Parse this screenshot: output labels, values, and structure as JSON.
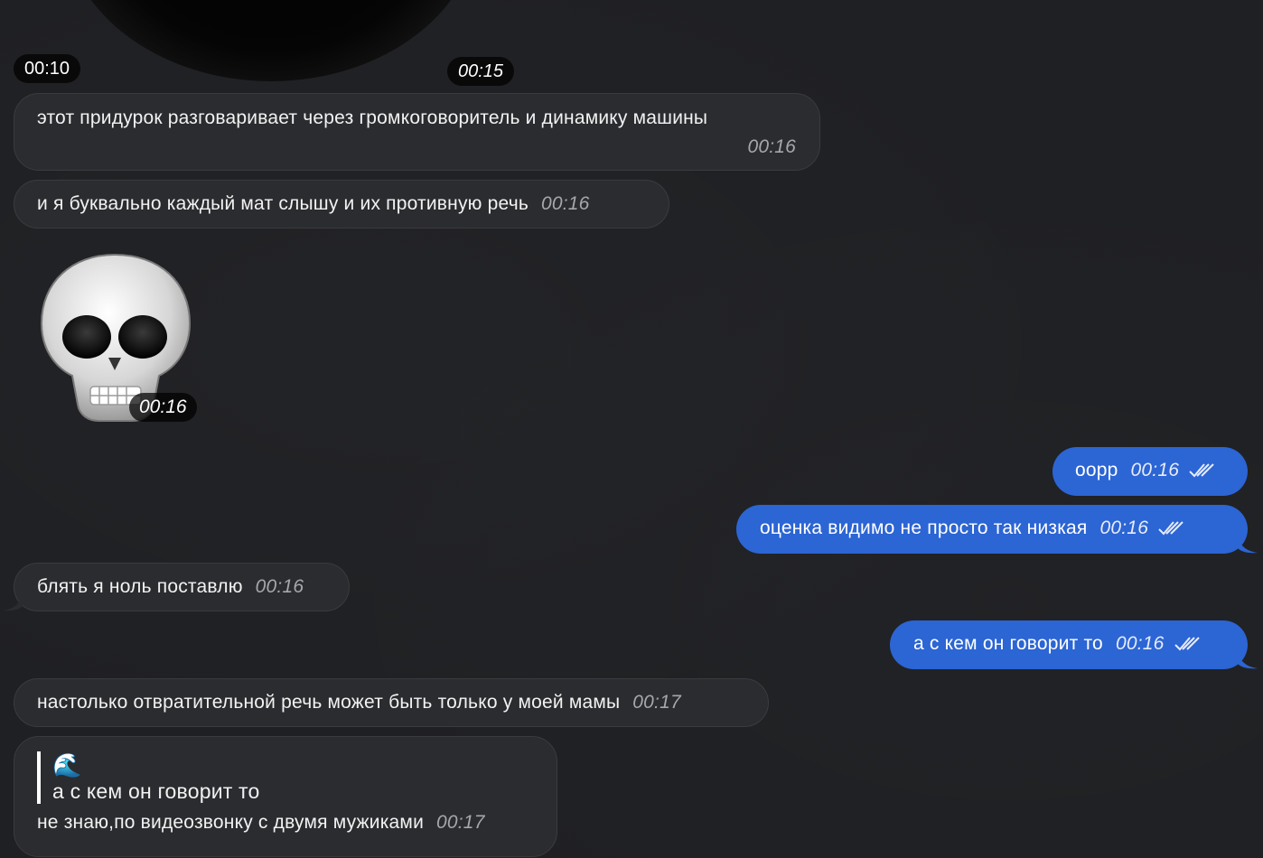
{
  "video_message": {
    "elapsed_label": "00:10",
    "time": "00:15"
  },
  "messages": [
    {
      "id": "m1",
      "direction": "in",
      "text": "этот придурок разговаривает через громкоговоритель и динамику машины",
      "time": "00:16"
    },
    {
      "id": "m2",
      "direction": "in",
      "text": "и я буквально каждый мат слышу и их противную речь",
      "time": "00:16"
    },
    {
      "id": "m3",
      "direction": "in",
      "type": "sticker",
      "sticker_icon": "skull-emoji",
      "time": "00:16"
    },
    {
      "id": "m4",
      "direction": "out",
      "text": "оорр",
      "time": "00:16",
      "status": "read"
    },
    {
      "id": "m5",
      "direction": "out",
      "text": "оценка видимо не просто так низкая",
      "time": "00:16",
      "status": "read"
    },
    {
      "id": "m6",
      "direction": "in",
      "text": "блять я ноль поставлю",
      "time": "00:16"
    },
    {
      "id": "m7",
      "direction": "out",
      "text": "а с кем он говорит то",
      "time": "00:16",
      "status": "read"
    },
    {
      "id": "m8",
      "direction": "in",
      "text": "настолько отвратительной речь может быть только у моей мамы",
      "time": "00:17"
    },
    {
      "id": "m9",
      "direction": "in",
      "reply_to": {
        "author_emoji": "🌊",
        "text": "а с кем он говорит то"
      },
      "text": "не знаю,по видеозвонку с двумя мужиками",
      "time": "00:17"
    }
  ],
  "colors": {
    "background": "#1f2023",
    "incoming_bubble": "#2b2c2f",
    "outgoing_bubble": "#2c65d4"
  }
}
